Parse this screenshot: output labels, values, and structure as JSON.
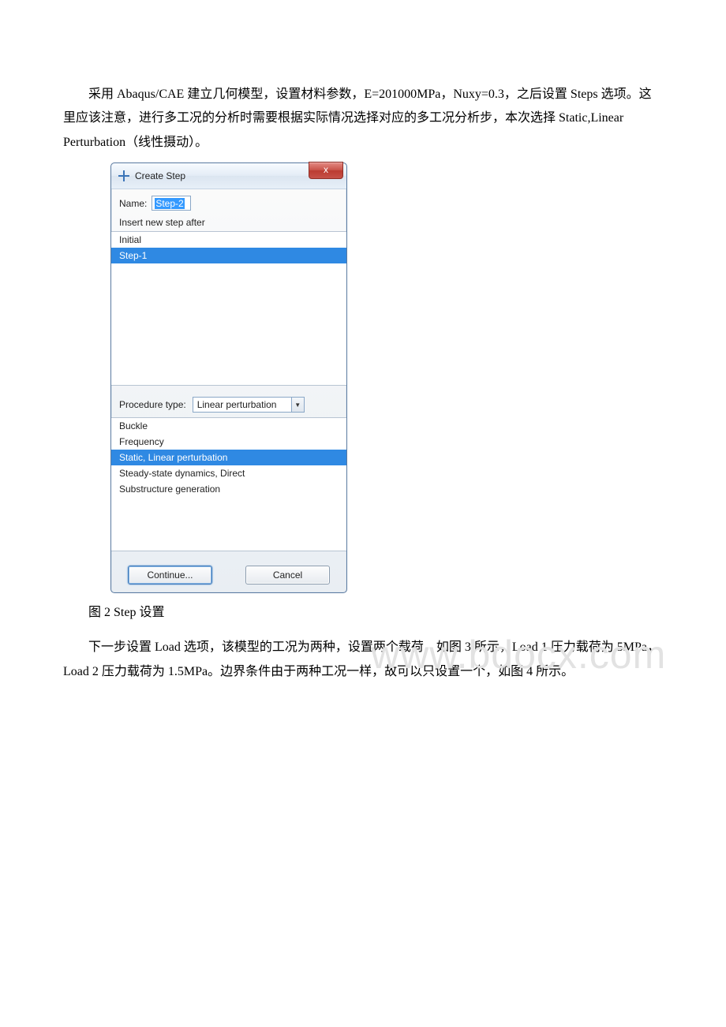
{
  "paragraphs": {
    "p1": "采用 Abaqus/CAE 建立几何模型，设置材料参数，E=201000MPa，Nuxy=0.3，之后设置 Steps 选项。这里应该注意，进行多工况的分析时需要根据实际情况选择对应的多工况分析步，本次选择 Static,Linear Perturbation（线性摄动）。",
    "caption": "图 2 Step 设置",
    "p2": "下一步设置 Load 选项，该模型的工况为两种，设置两个载荷，如图 3 所示，Load 1 压力载荷为 5MPa，Load 2 压力载荷为 1.5MPa。边界条件由于两种工况一样，故可以只设置一个，如图 4 所示。"
  },
  "watermark": "www.bdocx.com",
  "dialog": {
    "title": "Create Step",
    "close_glyph": "x",
    "name_label": "Name:",
    "name_value": "Step-2",
    "insert_label": "Insert new step after",
    "steps": [
      {
        "label": "Initial",
        "selected": false
      },
      {
        "label": "Step-1",
        "selected": true
      }
    ],
    "procedure_label": "Procedure type:",
    "procedure_value": "Linear perturbation",
    "procedures": [
      {
        "label": "Buckle",
        "selected": false
      },
      {
        "label": "Frequency",
        "selected": false
      },
      {
        "label": "Static, Linear perturbation",
        "selected": true
      },
      {
        "label": "Steady-state dynamics, Direct",
        "selected": false
      },
      {
        "label": "Substructure generation",
        "selected": false
      }
    ],
    "continue_label": "Continue...",
    "cancel_label": "Cancel"
  }
}
